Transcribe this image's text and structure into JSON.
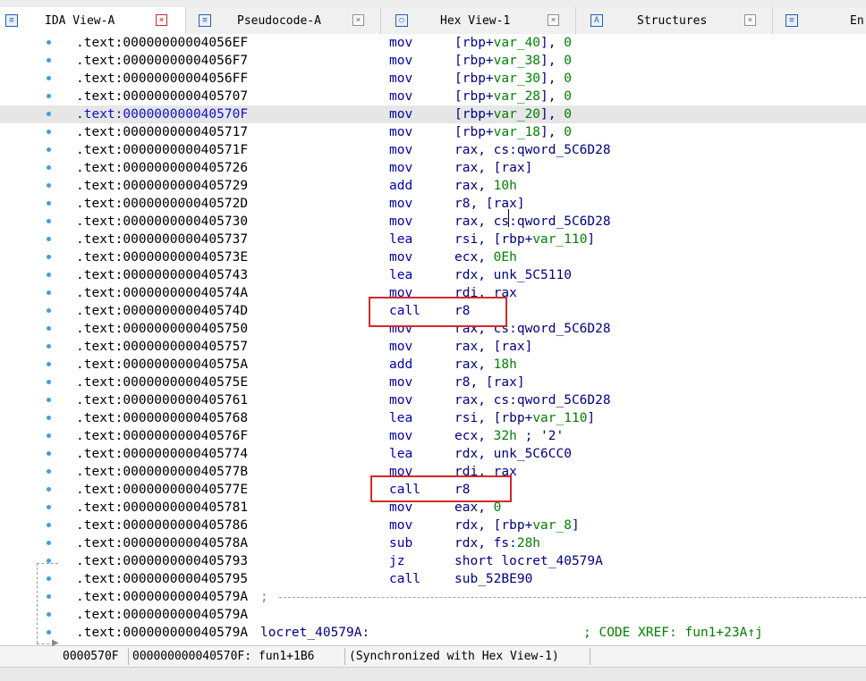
{
  "tabs": [
    {
      "label": "IDA View-A",
      "icon": "ida-view-icon",
      "active": true
    },
    {
      "label": "Pseudocode-A",
      "icon": "pseudocode-icon",
      "active": false
    },
    {
      "label": "Hex View-1",
      "icon": "hex-view-icon",
      "active": false
    },
    {
      "label": "Structures",
      "icon": "structures-icon",
      "active": false
    },
    {
      "label": "En",
      "icon": "enums-icon",
      "active": false
    }
  ],
  "close_glyph": "×",
  "listing": {
    "rows": [
      {
        "addr": ".text:00000000004056EF",
        "mn": "mov",
        "op": "[rbp+",
        "opv": "var_40",
        "op2": "], ",
        "num": "0"
      },
      {
        "addr": ".text:00000000004056F7",
        "mn": "mov",
        "op": "[rbp+",
        "opv": "var_38",
        "op2": "], ",
        "num": "0"
      },
      {
        "addr": ".text:00000000004056FF",
        "mn": "mov",
        "op": "[rbp+",
        "opv": "var_30",
        "op2": "], ",
        "num": "0"
      },
      {
        "addr": ".text:0000000000405707",
        "mn": "mov",
        "op": "[rbp+",
        "opv": "var_28",
        "op2": "], ",
        "num": "0"
      },
      {
        "addr": ".text:000000000040570F",
        "mn": "mov",
        "op": "[rbp+",
        "opv": "var_20",
        "op2": "], ",
        "num": "0"
      },
      {
        "addr": ".text:0000000000405717",
        "mn": "mov",
        "op": "[rbp+",
        "opv": "var_18",
        "op2": "], ",
        "num": "0"
      },
      {
        "addr": ".text:000000000040571F",
        "mn": "mov",
        "op": "rax, cs:qword_5C6D28"
      },
      {
        "addr": ".text:0000000000405726",
        "mn": "mov",
        "op": "rax, [rax]"
      },
      {
        "addr": ".text:0000000000405729",
        "mn": "add",
        "op": "rax, ",
        "num": "10h"
      },
      {
        "addr": ".text:000000000040572D",
        "mn": "mov",
        "op": "r8, [rax]"
      },
      {
        "addr": ".text:0000000000405730",
        "mn": "mov",
        "op": "rax, cs:qword_5C6D28"
      },
      {
        "addr": ".text:0000000000405737",
        "mn": "lea",
        "op": "rsi, [rbp+",
        "opv": "var_110",
        "op2": "]"
      },
      {
        "addr": ".text:000000000040573E",
        "mn": "mov",
        "op": "ecx, ",
        "num": "0Eh"
      },
      {
        "addr": ".text:0000000000405743",
        "mn": "lea",
        "op": "rdx, unk_5C5110"
      },
      {
        "addr": ".text:000000000040574A",
        "mn": "mov",
        "op": "rdi, rax"
      },
      {
        "addr": ".text:000000000040574D",
        "mn": "call",
        "op": "r8"
      },
      {
        "addr": ".text:0000000000405750",
        "mn": "mov",
        "op": "rax, cs:qword_5C6D28"
      },
      {
        "addr": ".text:0000000000405757",
        "mn": "mov",
        "op": "rax, [rax]"
      },
      {
        "addr": ".text:000000000040575A",
        "mn": "add",
        "op": "rax, ",
        "num": "18h"
      },
      {
        "addr": ".text:000000000040575E",
        "mn": "mov",
        "op": "r8, [rax]"
      },
      {
        "addr": ".text:0000000000405761",
        "mn": "mov",
        "op": "rax, cs:qword_5C6D28"
      },
      {
        "addr": ".text:0000000000405768",
        "mn": "lea",
        "op": "rsi, [rbp+",
        "opv": "var_110",
        "op2": "]"
      },
      {
        "addr": ".text:000000000040576F",
        "mn": "mov",
        "op": "ecx, ",
        "num": "32h",
        "cmt": " ; '2'"
      },
      {
        "addr": ".text:0000000000405774",
        "mn": "lea",
        "op": "rdx, unk_5C6CC0"
      },
      {
        "addr": ".text:000000000040577B",
        "mn": "mov",
        "op": "rdi, rax"
      },
      {
        "addr": ".text:000000000040577E",
        "mn": "call",
        "op": "r8"
      },
      {
        "addr": ".text:0000000000405781",
        "mn": "mov",
        "op": "eax, ",
        "num": "0"
      },
      {
        "addr": ".text:0000000000405786",
        "mn": "mov",
        "op": "rdx, [rbp+",
        "opv": "var_8",
        "op2": "]"
      },
      {
        "addr": ".text:000000000040578A",
        "mn": "sub",
        "op": "rdx, fs:",
        "num": "28h"
      },
      {
        "addr": ".text:0000000000405793",
        "mn": "jz",
        "op": "short locret_40579A"
      },
      {
        "addr": ".text:0000000000405795",
        "mn": "call",
        "op": "sub_52BE90"
      }
    ],
    "sep_row": {
      "addr": ".text:000000000040579A",
      "sep": ";"
    },
    "blank_row": {
      "addr": ".text:000000000040579A"
    },
    "label_row": {
      "addr": ".text:000000000040579A",
      "label": "locret_40579A:",
      "xref": "; CODE XREF: fun1+23A↑j"
    }
  },
  "status": {
    "offset": "0000570F",
    "location": "000000000040570F: fun1+1B6",
    "sync": "(Synchronized with Hex View-1)"
  },
  "colors": {
    "accent_box": "#d62828",
    "bullet": "#3aa0e4",
    "mnemonic": "#0000aa",
    "number": "#008000",
    "highlight": "#e6e6e6"
  }
}
